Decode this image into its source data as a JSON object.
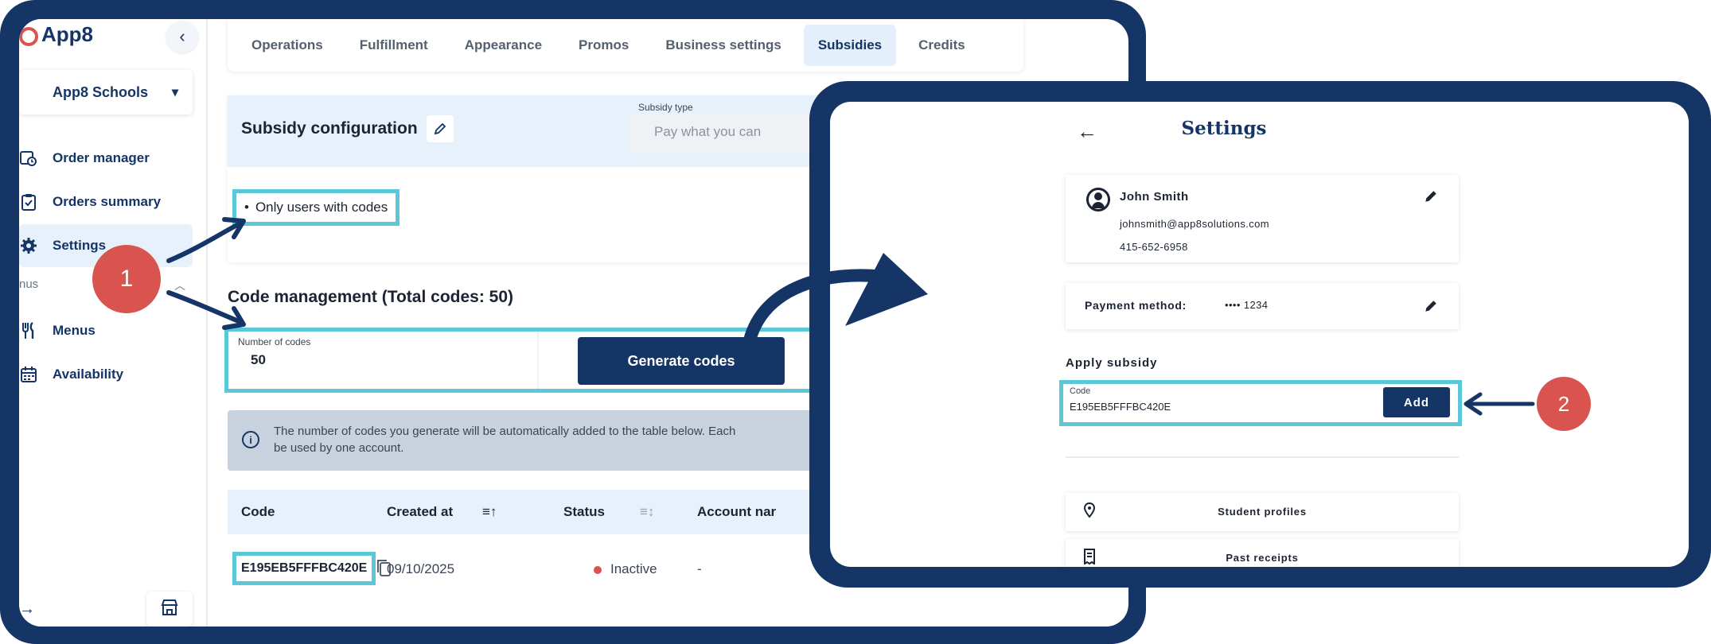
{
  "colors": {
    "frame": "#143566",
    "highlight": "#5bc8d8",
    "marker": "#d9534f",
    "accent_bg": "#e7f1fb",
    "primary": "#143566"
  },
  "left_screen": {
    "brand": "App8",
    "org_selector": "App8 Schools",
    "nav": {
      "order_manager": "Order manager",
      "orders_summary": "Orders summary",
      "settings": "Settings",
      "group_label": "nus",
      "menus": "Menus",
      "availability": "Availability"
    },
    "tabs": [
      "Operations",
      "Fulfillment",
      "Appearance",
      "Promos",
      "Business settings",
      "Subsidies",
      "Credits"
    ],
    "active_tab": "Subsidies",
    "subsidy_config": {
      "title": "Subsidy configuration",
      "type_label": "Subsidy type",
      "type_placeholder": "Pay what you can",
      "restriction": "Only users with codes"
    },
    "code_management": {
      "title": "Code management (Total codes: 50)",
      "number_label": "Number of codes",
      "number_value": "50",
      "generate_button": "Generate codes",
      "info_line1": "The number of codes you generate will be automatically added to the table below. Each",
      "info_line2": "be used by one account."
    },
    "table": {
      "headers": {
        "code": "Code",
        "created_at": "Created at",
        "status": "Status",
        "account": "Account nar"
      },
      "row": {
        "code": "E195EB5FFFBC420E",
        "created_at": "09/10/2025",
        "status": "Inactive",
        "account": "-"
      }
    }
  },
  "right_screen": {
    "title": "Settings",
    "profile": {
      "name": "John Smith",
      "email": "johnsmith@app8solutions.com",
      "phone": "415-652-6958"
    },
    "payment": {
      "label": "Payment method:",
      "value": "•••• 1234"
    },
    "apply_subsidy": {
      "label": "Apply subsidy",
      "code_label": "Code",
      "code_value": "E195EB5FFFBC420E",
      "add_button": "Add"
    },
    "menu_items": [
      "Student profiles",
      "Past receipts"
    ]
  },
  "annotations": {
    "step1": "1",
    "step2": "2"
  }
}
